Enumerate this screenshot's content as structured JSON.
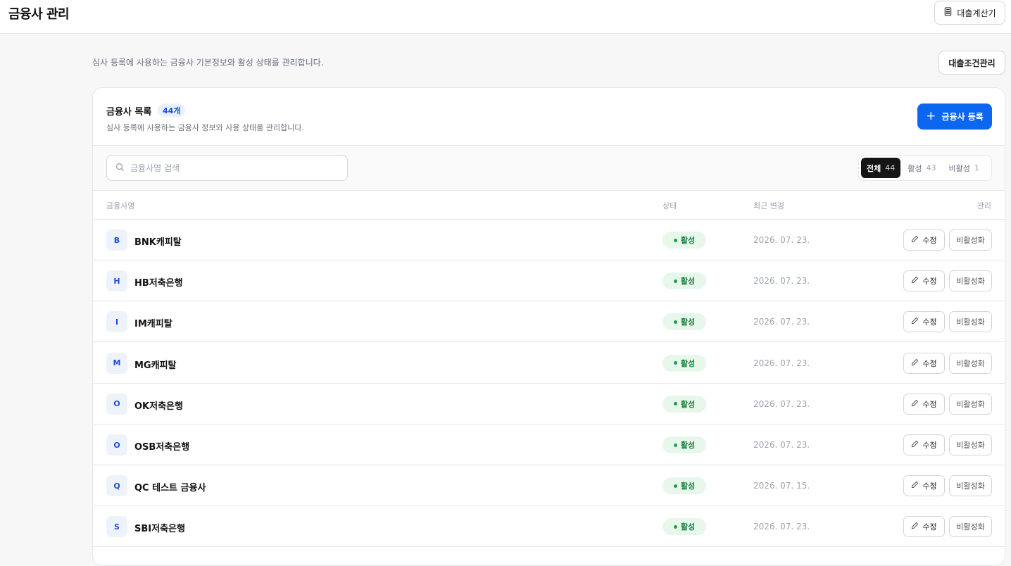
{
  "header": {
    "title": "금융사 관리",
    "calculator_label": "대출계산기",
    "calculator_icon": "calculator-icon"
  },
  "page": {
    "description": "심사 등록에 사용하는 금융사 기본정보와 활성 상태를 관리합니다.",
    "loan_condition_label": "대출조건관리"
  },
  "card": {
    "title": "금융사 목록",
    "count_badge": "44개",
    "subtitle": "심사 등록에 사용하는 금융사 정보와 사용 상태를 관리합니다.",
    "register_plus": "+",
    "register_label": "금융사 등록"
  },
  "search": {
    "placeholder": "금융사명 검색",
    "value": ""
  },
  "filters": [
    {
      "label": "전체",
      "count": "44",
      "active": true
    },
    {
      "label": "활성",
      "count": "43",
      "active": false
    },
    {
      "label": "비활성",
      "count": "1",
      "active": false
    }
  ],
  "table": {
    "columns": {
      "name": "금융사명",
      "status": "상태",
      "date": "최근 변경",
      "manage": "관리"
    },
    "edit_label": "수정",
    "deactivate_label": "비활성화",
    "rows": [
      {
        "initial": "B",
        "name": "BNK캐피탈",
        "status": "활성",
        "date": "2026. 07. 23."
      },
      {
        "initial": "H",
        "name": "HB저축은행",
        "status": "활성",
        "date": "2026. 07. 23."
      },
      {
        "initial": "I",
        "name": "IM캐피탈",
        "status": "활성",
        "date": "2026. 07. 23."
      },
      {
        "initial": "M",
        "name": "MG캐피탈",
        "status": "활성",
        "date": "2026. 07. 23."
      },
      {
        "initial": "O",
        "name": "OK저축은행",
        "status": "활성",
        "date": "2026. 07. 23."
      },
      {
        "initial": "O",
        "name": "OSB저축은행",
        "status": "활성",
        "date": "2026. 07. 23."
      },
      {
        "initial": "Q",
        "name": "QC 테스트 금융사",
        "status": "활성",
        "date": "2026. 07. 15."
      },
      {
        "initial": "S",
        "name": "SBI저축은행",
        "status": "활성",
        "date": "2026. 07. 23."
      }
    ]
  },
  "colors": {
    "primary": "#0b66f0",
    "active_green": "#15803d",
    "active_bg": "#e7f7ec",
    "avatar_text": "#1d4ed8"
  }
}
